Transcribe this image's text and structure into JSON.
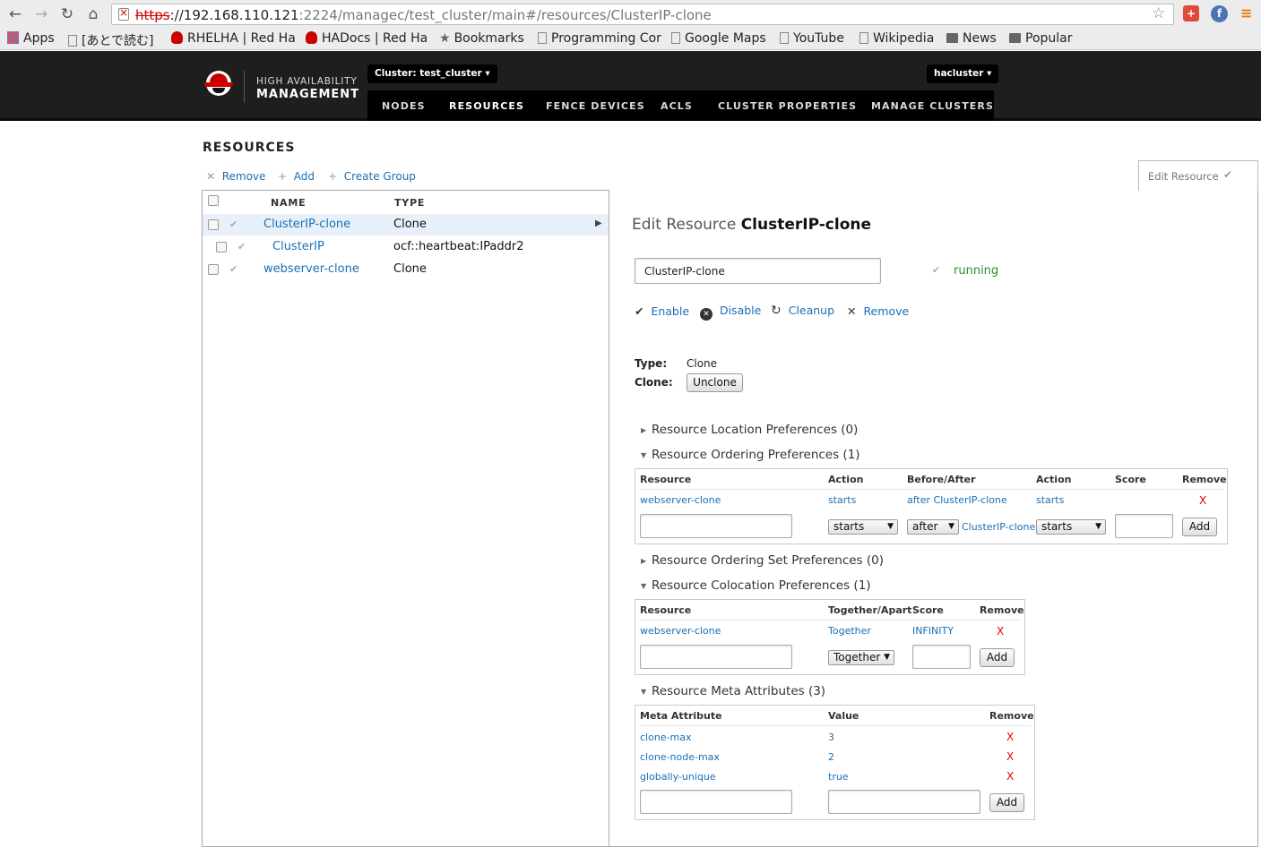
{
  "browser": {
    "url_scheme": "https",
    "url_host": "://192.168.110.121",
    "url_rest": ":2224/managec/test_cluster/main#/resources/ClusterIP-clone",
    "bookmarks": [
      "Apps",
      "[あとで読む]",
      "RHELHA | Red Ha",
      "HADocs | Red Ha",
      "Bookmarks",
      "Programming Cor",
      "Google Maps",
      "YouTube",
      "Wikipedia",
      "News",
      "Popular"
    ]
  },
  "header": {
    "logo_line1": "HIGH AVAILABILITY",
    "logo_line2": "MANAGEMENT",
    "cluster_dropdown": "Cluster: test_cluster",
    "user_dropdown": "hacluster",
    "nav": [
      "NODES",
      "RESOURCES",
      "FENCE DEVICES",
      "ACLS",
      "CLUSTER PROPERTIES",
      "MANAGE CLUSTERS"
    ]
  },
  "page": {
    "title": "RESOURCES",
    "actions": {
      "remove": "Remove",
      "add": "Add",
      "create_group": "Create Group"
    },
    "edit_tab": "Edit Resource"
  },
  "resource_table": {
    "headers": {
      "name": "NAME",
      "type": "TYPE"
    },
    "rows": [
      {
        "name": "ClusterIP-clone",
        "type": "Clone"
      },
      {
        "name": "ClusterIP",
        "type": "ocf::heartbeat:IPaddr2"
      },
      {
        "name": "webserver-clone",
        "type": "Clone"
      }
    ]
  },
  "detail": {
    "title_prefix": "Edit Resource",
    "title_name": "ClusterIP-clone",
    "name_field": "ClusterIP-clone",
    "status": "running",
    "actions": {
      "enable": "Enable",
      "disable": "Disable",
      "cleanup": "Cleanup",
      "remove": "Remove"
    },
    "type_label": "Type:",
    "type_value": "Clone",
    "clone_label": "Clone:",
    "unclone_button": "Unclone",
    "sections": {
      "location": "Resource Location Preferences (0)",
      "ordering": "Resource Ordering Preferences (1)",
      "ordering_set": "Resource Ordering Set Preferences (0)",
      "colocation": "Resource Colocation Preferences (1)",
      "meta": "Resource Meta Attributes (3)"
    },
    "ordering_table": {
      "headers": [
        "Resource",
        "Action",
        "Before/After",
        "Action",
        "Score",
        "Remove"
      ],
      "row": {
        "resource": "webserver-clone",
        "action": "starts",
        "before_after": "after ClusterIP-clone",
        "action2": "starts",
        "score": "",
        "remove": "X"
      },
      "form": {
        "action": "starts",
        "before_after": "after",
        "target": "ClusterIP-clone",
        "action2": "starts",
        "add": "Add"
      }
    },
    "colocation_table": {
      "headers": [
        "Resource",
        "Together/Apart",
        "Score",
        "Remove"
      ],
      "row": {
        "resource": "webserver-clone",
        "together": "Together",
        "score": "INFINITY",
        "remove": "X"
      },
      "form": {
        "together": "Together",
        "add": "Add"
      }
    },
    "meta_table": {
      "headers": [
        "Meta Attribute",
        "Value",
        "Remove"
      ],
      "rows": [
        {
          "attr": "clone-max",
          "value": "3",
          "remove": "X"
        },
        {
          "attr": "clone-node-max",
          "value": "2",
          "remove": "X"
        },
        {
          "attr": "globally-unique",
          "value": "true",
          "remove": "X"
        }
      ],
      "form": {
        "add": "Add"
      }
    }
  }
}
